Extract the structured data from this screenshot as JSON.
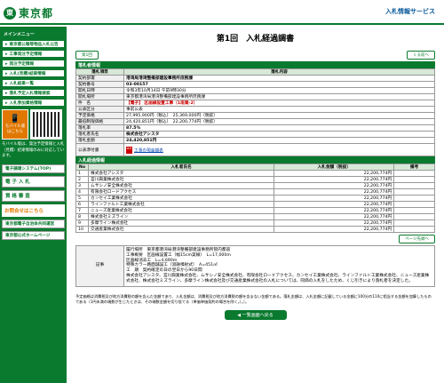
{
  "header": {
    "logo_mark": "東",
    "logo_text": "東京都",
    "service": "入札情報サービス"
  },
  "sidebar": {
    "menu_heading": "メインメニュー",
    "items": [
      "東京都公報等物品入札公告",
      "工事発注予定情報",
      "発注予定情報",
      "入札(見積)結果情報",
      "入札結果一覧",
      "落札予定入札情報検索",
      "入札参加資格情報"
    ],
    "mobile_label": "モバイル版\nはこちら",
    "mobile_note": "モバイル版は、発注予定情報と入札（見積）結果情報のみに対応しています。",
    "btn_system": "電子調達システム(TOP)",
    "btn_bid": "電 子 入 札",
    "btn_qual": "資 格 審 査",
    "inquiry": "お問合せはこちら",
    "links": [
      "東京都電子自治体共同運営",
      "東京都公式ホームページ"
    ]
  },
  "main": {
    "title": "第1回　入札経過調書",
    "back_top": "くる前へ",
    "back_list": "◀ 一覧画面へ戻る",
    "badge": "第1回",
    "info_section": "落札者情報",
    "info_head": [
      "落札項目",
      "落札内容"
    ],
    "info_rows": [
      [
        "契約部署",
        "港湾局港湾整備部建設事務所庶務課"
      ],
      [
        "契約番号",
        "03-00157"
      ],
      [
        "開札日時",
        "令和3年10月14日 午前9時30分"
      ],
      [
        "開札場所",
        "東京都港湾局港湾整備部建設事務所庶務課"
      ],
      [
        "件　名",
        "【電子】 区画線設置工事（1南業-2）"
      ],
      [
        "公表区分",
        "事前公表"
      ],
      [
        "予定価格",
        "27,995,900円（税込）　25,369,000円（税抜）"
      ],
      [
        "最低制限価格",
        "24,420,851円（税込）　22,200,774円（税抜）"
      ],
      [
        "落札率",
        "87.5%"
      ],
      [
        "落札者氏名",
        "株式会社アシスタ"
      ],
      [
        "落札金額",
        "24,420,851円"
      ]
    ],
    "publish_label": "公表添付書",
    "publish_link": "工事の現金額表",
    "bid_section": "入札経過情報",
    "bid_head": [
      "No",
      "入札者氏名",
      "入札金額（税抜）",
      "備考"
    ],
    "bids": [
      [
        "1",
        "株式会社アシスタ",
        "22,200,774円",
        ""
      ],
      [
        "2",
        "宮川興業株式会社",
        "22,200,774円",
        ""
      ],
      [
        "3",
        "ムサシノ安全株式会社",
        "22,200,774円",
        ""
      ],
      [
        "4",
        "有限会社ロードアクセス",
        "22,200,774円",
        ""
      ],
      [
        "5",
        "カンセイ工業株式会社",
        "22,200,774円",
        ""
      ],
      [
        "6",
        "ラインファルト工業株式会社",
        "22,200,774円",
        ""
      ],
      [
        "7",
        "ニューズ産業株式会社",
        "22,200,774円",
        ""
      ],
      [
        "8",
        "株式会社ミズライン",
        "22,200,774円",
        ""
      ],
      [
        "9",
        "多摩ライン株式会社",
        "22,200,774円",
        ""
      ],
      [
        "10",
        "交通産業株式会社",
        "22,200,774円",
        ""
      ]
    ],
    "remarks_btn": "ページ先頭へ",
    "remarks_label": "記事",
    "remarks": "履行場所　東京都港湾局港湾整備部建設事務所管内都道\n工事概要　区画線設置工（幅15cm実線）　L=17,000m\n区画線消去工　L=4,690m\n特殊カラー路面舗設工（溶融噴射式）　A=451㎡\n工　期　契約確定の日の翌日から90日間\n株式会社アシスタ、宮川興業株式会社、ムサシノ安全株式会社、有限会社ロードアクセス、カンセイ工業株式会社、ラインファルト工業株式会社、ニューズ産業株式会社、株式会社ミズライン、多摩ライン株式会社及び交通産業株式会社の入札については、同価の入札をしたため、くじ引きにより落札者を決定した。",
    "foot_note": "予定価格は消費税及び地方消費税の額を含んだ金額であり、入札金額は、消費税及び地方消費税の額を含まない金額である。落札金額は、入札金額に記載している金額に100分の110に相当する金額を加算したものである（1円未満の端数が生じたときは、その端数金額を切り捨てる（単価単価契約の場合を除く。）。）。"
  }
}
